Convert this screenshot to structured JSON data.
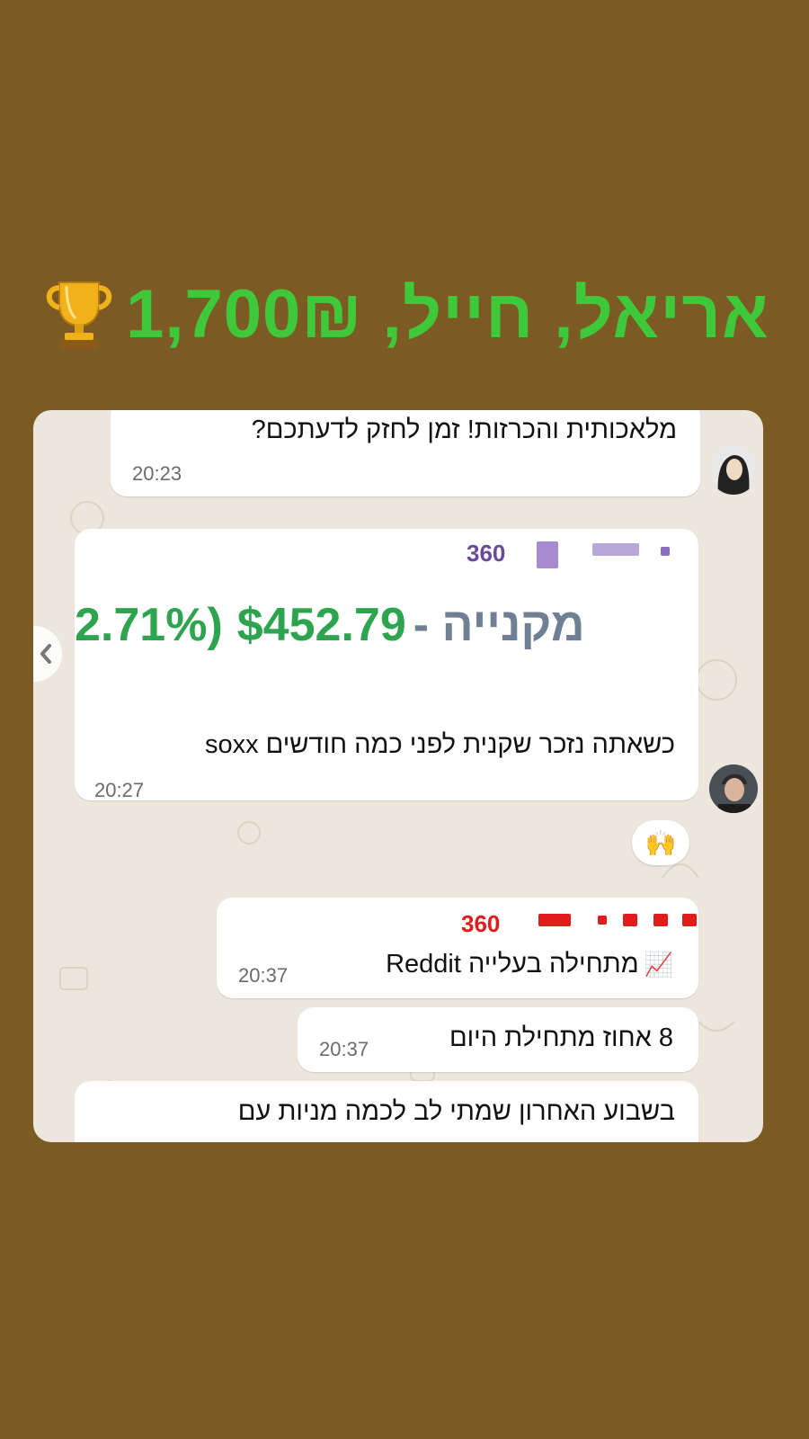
{
  "headline": {
    "text": "אריאל, חייל, 1,700₪",
    "trophy_icon": "trophy-icon",
    "color": "#3fc93a"
  },
  "background_color": "#7b5a24",
  "chat": {
    "messages": [
      {
        "text": "מלאכותית והכרזות! זמן לחזק לדעתכם?",
        "time": "20:23",
        "avatar": "avatar-woman"
      },
      {
        "group_count": "360",
        "group_count_color": "#6b4a9a",
        "price_prefix": "מקנייה - ",
        "price_value": "$452.79",
        "price_pct": ".71%)",
        "price_lead": "2",
        "price_color": "#2ea44f",
        "text": "כשאתה נזכר שקנית לפני כמה חודשים soxx",
        "time": "20:27",
        "avatar": "avatar-man",
        "reaction": "🙌"
      },
      {
        "group_count": "360",
        "group_count_color": "#e21b1b",
        "text": "מתחילה בעלייה Reddit",
        "emoji": "📈",
        "time": "20:37"
      },
      {
        "text": "8 אחוז מתחילת היום",
        "time": "20:37"
      },
      {
        "text": "בשבוע האחרון שמתי לב לכמה מניות עם"
      }
    ]
  }
}
